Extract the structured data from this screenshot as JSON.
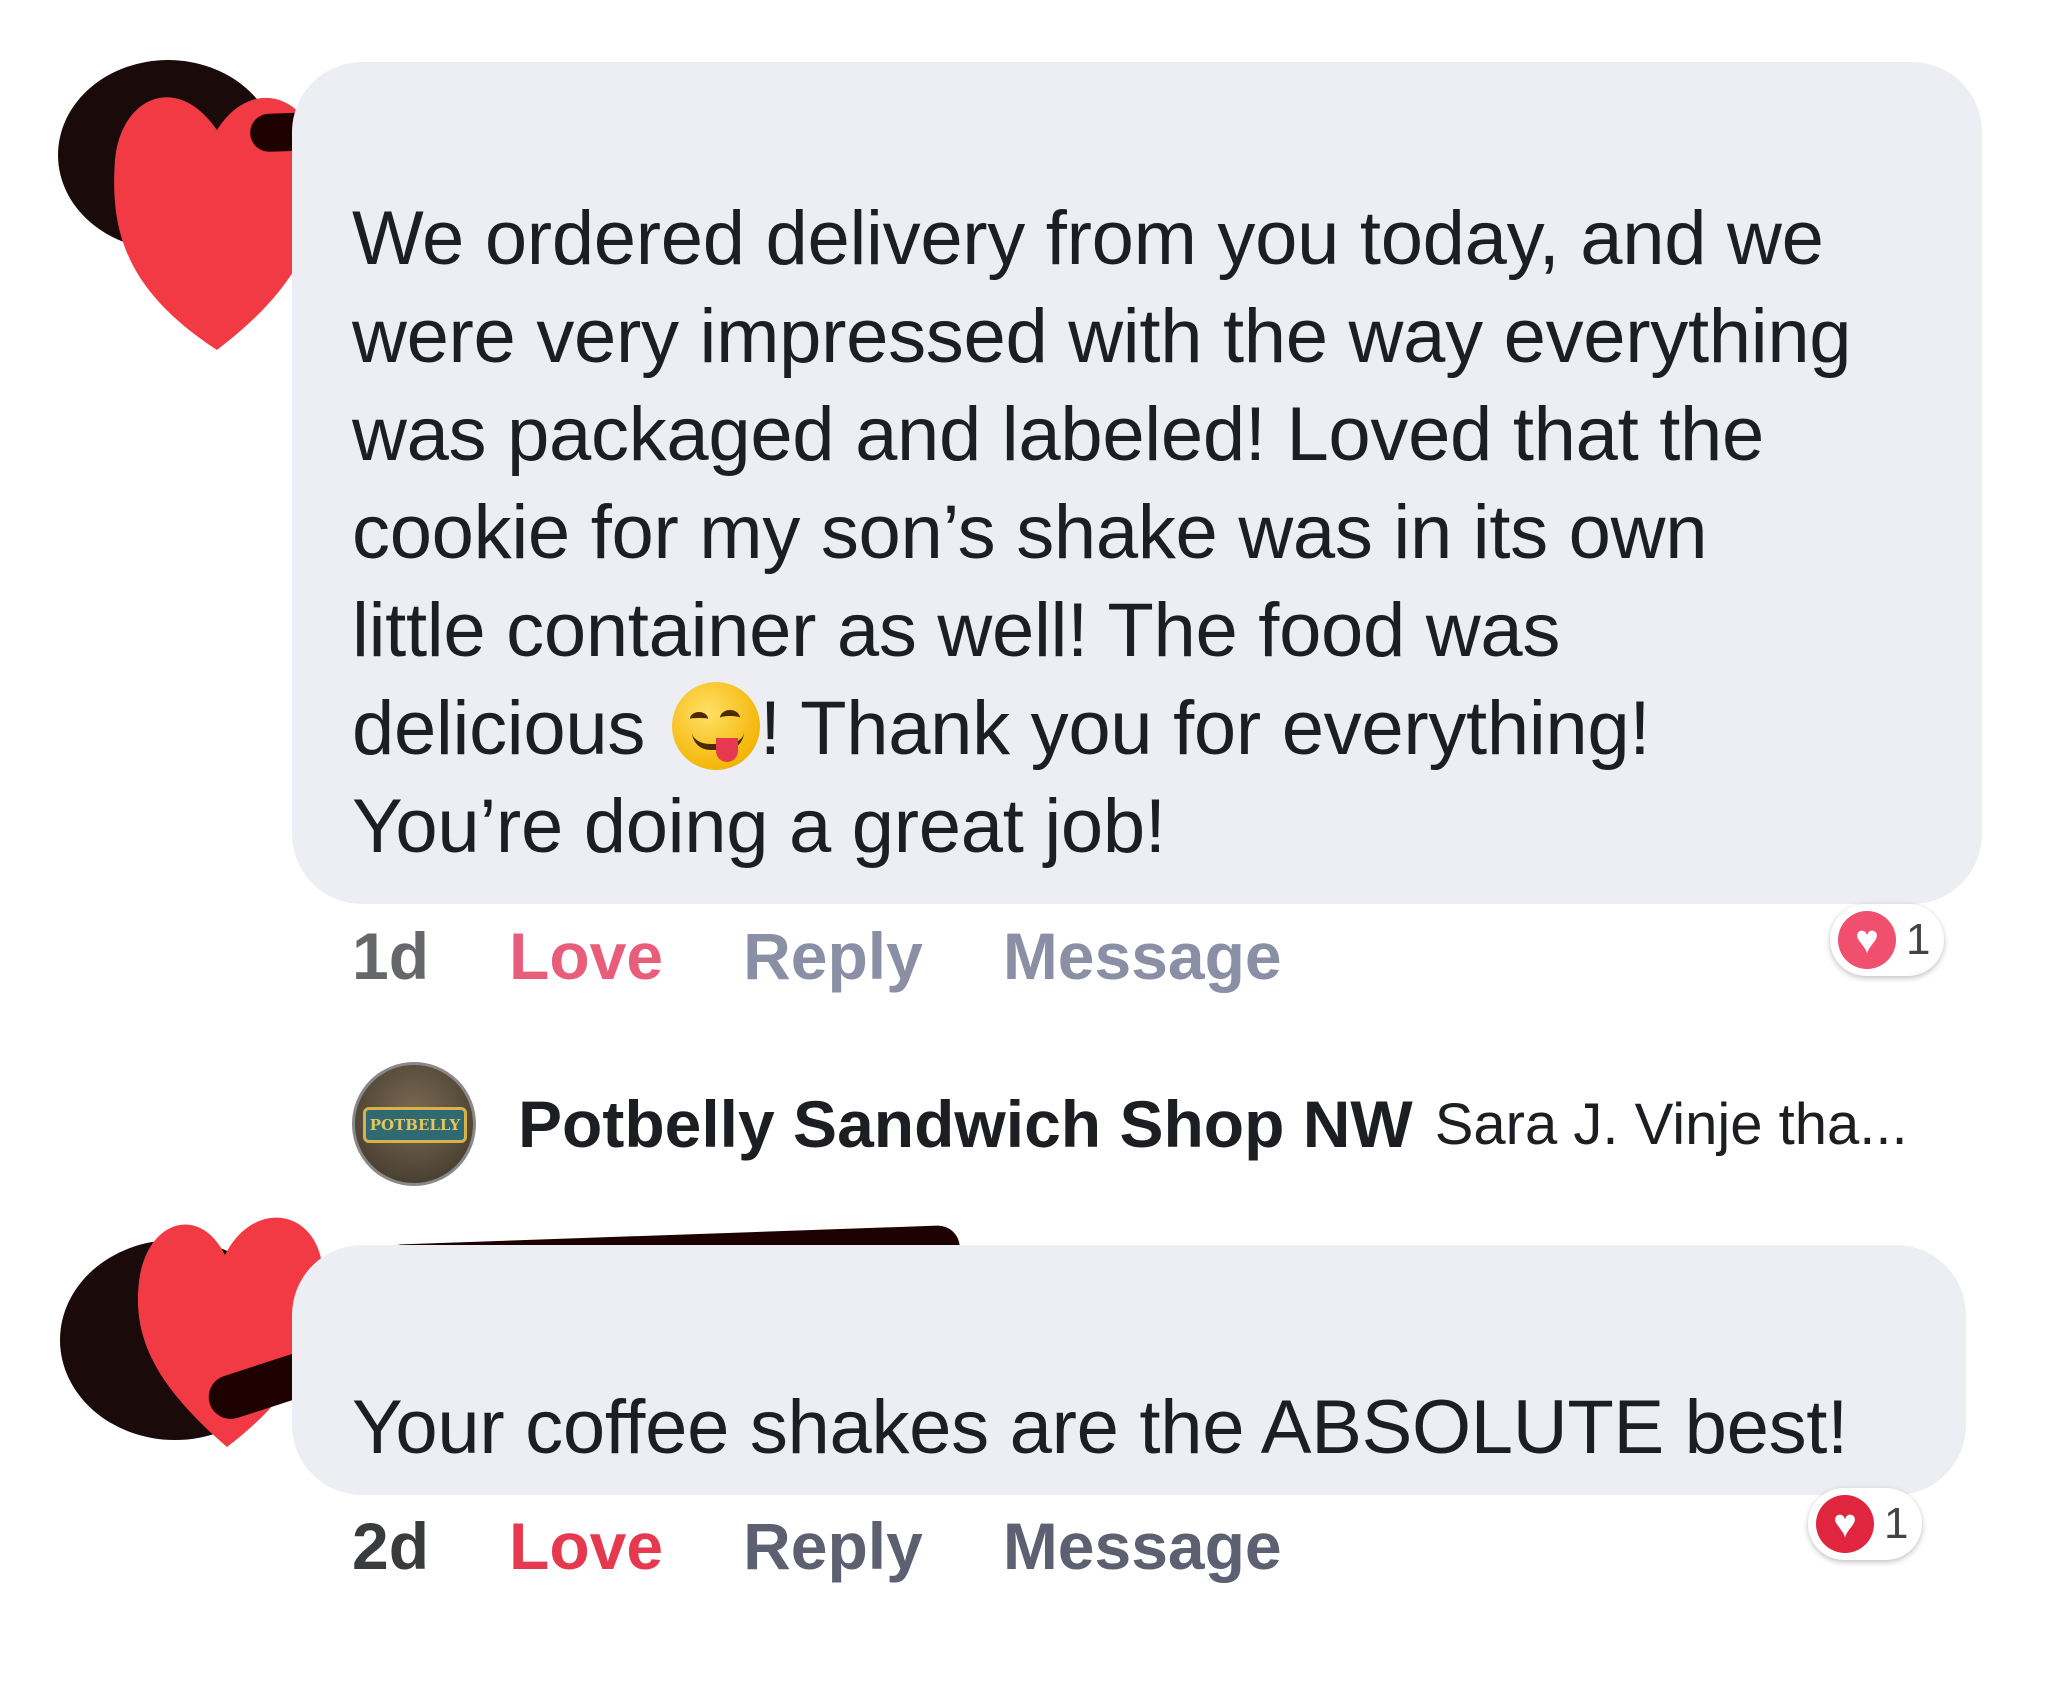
{
  "comments": [
    {
      "text_before_emoji": "We ordered delivery from you today, and we\nwere very impressed with the way everything\nwas packaged and labeled! Loved that the\ncookie for my son’s shake was in its own\nlittle container as well! The food was\ndelicious ",
      "emoji_icon": "face-savoring-food-emoji",
      "text_after_emoji": "! Thank you for everything!\nYou’re doing a great job!",
      "timestamp": "1d",
      "love_label": "Love",
      "reply_label": "Reply",
      "message_label": "Message",
      "reaction_count": "1",
      "reaction_icon": "heart-icon"
    },
    {
      "text": "Your coffee shakes are the ABSOLUTE best!",
      "timestamp": "2d",
      "love_label": "Love",
      "reply_label": "Reply",
      "message_label": "Message",
      "reaction_count": "1",
      "reaction_icon": "heart-icon"
    }
  ],
  "page_reply": {
    "avatar_text": "POTBELLY",
    "name": "Potbelly Sandwich Shop NW",
    "text": "Sara J. Vinje tha..."
  },
  "colors": {
    "bubble": "#eceef3",
    "love": "#e85d7a",
    "redaction": "#1e0202",
    "heart_overlay": "#f23a44"
  }
}
